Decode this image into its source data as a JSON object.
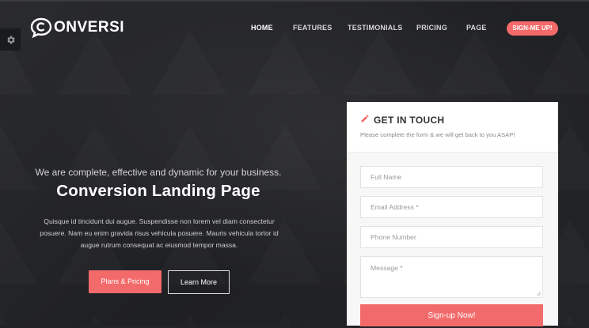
{
  "brand": {
    "name": "ONVERSI"
  },
  "nav": {
    "items": [
      {
        "label": "HOME",
        "active": true
      },
      {
        "label": "FEATURES",
        "active": false
      },
      {
        "label": "TESTIMONIALS",
        "active": false
      },
      {
        "label": "PRICING",
        "active": false
      },
      {
        "label": "PAGE",
        "active": false
      }
    ],
    "cta": "SIGN-ME UP!"
  },
  "settings": {
    "icon": "gear-icon"
  },
  "hero": {
    "subtitle": "We are complete, effective and dynamic for your business.",
    "title": "Conversion Landing Page",
    "description": "Quisque id tincidunt dui augue. Suspendisse non lorem vel diam consectetur posuere. Nam eu enim gravida risus vehicula posuere. Mauris vehicula tortor id augue rutrum consequat ac eiusmod tempor massa.",
    "primary_button": "Plans & Pricing",
    "secondary_button": "Learn More"
  },
  "form": {
    "title": "GET IN TOUCH",
    "icon": "pencil-icon",
    "subtitle": "Please complete the form & we will get back to you ASAP!",
    "fields": {
      "full_name": "Full Name",
      "email": "Email Address *",
      "phone": "Phone Number",
      "message": "Message *"
    },
    "submit": "Sign-up Now!"
  },
  "colors": {
    "accent": "#f36a6a",
    "background": "#222327",
    "card": "#ffffff"
  }
}
